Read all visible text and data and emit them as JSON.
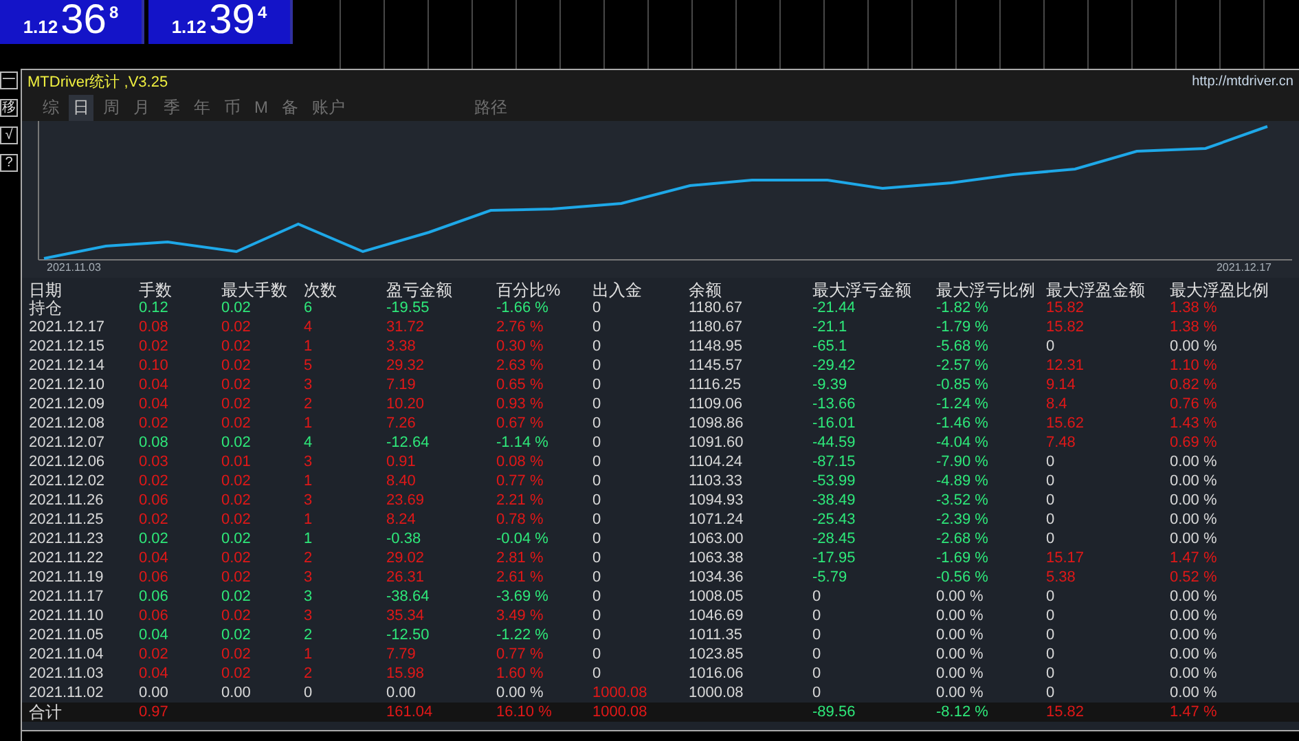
{
  "quotes": [
    {
      "prefix": "1.12",
      "big": "36",
      "sup": "8"
    },
    {
      "prefix": "1.12",
      "big": "39",
      "sup": "4"
    }
  ],
  "side_buttons": [
    "一",
    "移",
    "√",
    "?"
  ],
  "window": {
    "title": "MTDriver统计 ,V3.25",
    "url": "http://mtdriver.cn"
  },
  "tabs": [
    {
      "label": "综",
      "selected": false
    },
    {
      "label": "日",
      "selected": true
    },
    {
      "label": "周",
      "selected": false
    },
    {
      "label": "月",
      "selected": false
    },
    {
      "label": "季",
      "selected": false
    },
    {
      "label": "年",
      "selected": false
    },
    {
      "label": "币",
      "selected": false
    },
    {
      "label": "M",
      "selected": false
    },
    {
      "label": "备",
      "selected": false
    },
    {
      "label": "账户",
      "selected": false
    },
    {
      "label": "路径",
      "selected": false
    }
  ],
  "equity_chart": {
    "start_label": "2021.11.03",
    "end_label": "2021.12.17"
  },
  "table": {
    "columns": [
      "日期",
      "手数",
      "最大手数",
      "次数",
      "盈亏金额",
      "百分比%",
      "出入金",
      "余额",
      "最大浮亏金额",
      "最大浮亏比例",
      "最大浮盈金额",
      "最大浮盈比例"
    ],
    "rows": [
      {
        "kind": "open",
        "cells": [
          {
            "text": "持仓",
            "color": "#d8d8d8"
          },
          {
            "text": "0.12",
            "color": "#2ee87a"
          },
          {
            "text": "0.02",
            "color": "#2ee87a"
          },
          {
            "text": "6",
            "color": "#2ee87a"
          },
          {
            "text": "-19.55",
            "color": "#2ee87a"
          },
          {
            "text": "-1.66 %",
            "color": "#2ee87a"
          },
          {
            "text": "0",
            "color": "#d8d8d8"
          },
          {
            "text": "1180.67",
            "color": "#d8d8d8"
          },
          {
            "text": "-21.44",
            "color": "#2ee87a"
          },
          {
            "text": "-1.82 %",
            "color": "#2ee87a"
          },
          {
            "text": "15.82",
            "color": "#e01818"
          },
          {
            "text": "1.38 %",
            "color": "#e01818"
          }
        ]
      },
      {
        "kind": "day",
        "cells": [
          {
            "text": "2021.12.17",
            "color": "#d8d8d8"
          },
          {
            "text": "0.08",
            "color": "#e01818"
          },
          {
            "text": "0.02",
            "color": "#e01818"
          },
          {
            "text": "4",
            "color": "#e01818"
          },
          {
            "text": "31.72",
            "color": "#e01818"
          },
          {
            "text": "2.76 %",
            "color": "#e01818"
          },
          {
            "text": "0",
            "color": "#d8d8d8"
          },
          {
            "text": "1180.67",
            "color": "#d8d8d8"
          },
          {
            "text": "-21.1",
            "color": "#2ee87a"
          },
          {
            "text": "-1.79 %",
            "color": "#2ee87a"
          },
          {
            "text": "15.82",
            "color": "#e01818"
          },
          {
            "text": "1.38 %",
            "color": "#e01818"
          }
        ]
      },
      {
        "kind": "day",
        "cells": [
          {
            "text": "2021.12.15",
            "color": "#d8d8d8"
          },
          {
            "text": "0.02",
            "color": "#e01818"
          },
          {
            "text": "0.02",
            "color": "#e01818"
          },
          {
            "text": "1",
            "color": "#e01818"
          },
          {
            "text": "3.38",
            "color": "#e01818"
          },
          {
            "text": "0.30 %",
            "color": "#e01818"
          },
          {
            "text": "0",
            "color": "#d8d8d8"
          },
          {
            "text": "1148.95",
            "color": "#d8d8d8"
          },
          {
            "text": "-65.1",
            "color": "#2ee87a"
          },
          {
            "text": "-5.68 %",
            "color": "#2ee87a"
          },
          {
            "text": "0",
            "color": "#d8d8d8"
          },
          {
            "text": "0.00 %",
            "color": "#d8d8d8"
          }
        ]
      },
      {
        "kind": "day",
        "cells": [
          {
            "text": "2021.12.14",
            "color": "#d8d8d8"
          },
          {
            "text": "0.10",
            "color": "#e01818"
          },
          {
            "text": "0.02",
            "color": "#e01818"
          },
          {
            "text": "5",
            "color": "#e01818"
          },
          {
            "text": "29.32",
            "color": "#e01818"
          },
          {
            "text": "2.63 %",
            "color": "#e01818"
          },
          {
            "text": "0",
            "color": "#d8d8d8"
          },
          {
            "text": "1145.57",
            "color": "#d8d8d8"
          },
          {
            "text": "-29.42",
            "color": "#2ee87a"
          },
          {
            "text": "-2.57 %",
            "color": "#2ee87a"
          },
          {
            "text": "12.31",
            "color": "#e01818"
          },
          {
            "text": "1.10 %",
            "color": "#e01818"
          }
        ]
      },
      {
        "kind": "day",
        "cells": [
          {
            "text": "2021.12.10",
            "color": "#d8d8d8"
          },
          {
            "text": "0.04",
            "color": "#e01818"
          },
          {
            "text": "0.02",
            "color": "#e01818"
          },
          {
            "text": "3",
            "color": "#e01818"
          },
          {
            "text": "7.19",
            "color": "#e01818"
          },
          {
            "text": "0.65 %",
            "color": "#e01818"
          },
          {
            "text": "0",
            "color": "#d8d8d8"
          },
          {
            "text": "1116.25",
            "color": "#d8d8d8"
          },
          {
            "text": "-9.39",
            "color": "#2ee87a"
          },
          {
            "text": "-0.85 %",
            "color": "#2ee87a"
          },
          {
            "text": "9.14",
            "color": "#e01818"
          },
          {
            "text": "0.82 %",
            "color": "#e01818"
          }
        ]
      },
      {
        "kind": "day",
        "cells": [
          {
            "text": "2021.12.09",
            "color": "#d8d8d8"
          },
          {
            "text": "0.04",
            "color": "#e01818"
          },
          {
            "text": "0.02",
            "color": "#e01818"
          },
          {
            "text": "2",
            "color": "#e01818"
          },
          {
            "text": "10.20",
            "color": "#e01818"
          },
          {
            "text": "0.93 %",
            "color": "#e01818"
          },
          {
            "text": "0",
            "color": "#d8d8d8"
          },
          {
            "text": "1109.06",
            "color": "#d8d8d8"
          },
          {
            "text": "-13.66",
            "color": "#2ee87a"
          },
          {
            "text": "-1.24 %",
            "color": "#2ee87a"
          },
          {
            "text": "8.4",
            "color": "#e01818"
          },
          {
            "text": "0.76 %",
            "color": "#e01818"
          }
        ]
      },
      {
        "kind": "day",
        "cells": [
          {
            "text": "2021.12.08",
            "color": "#d8d8d8"
          },
          {
            "text": "0.02",
            "color": "#e01818"
          },
          {
            "text": "0.02",
            "color": "#e01818"
          },
          {
            "text": "1",
            "color": "#e01818"
          },
          {
            "text": "7.26",
            "color": "#e01818"
          },
          {
            "text": "0.67 %",
            "color": "#e01818"
          },
          {
            "text": "0",
            "color": "#d8d8d8"
          },
          {
            "text": "1098.86",
            "color": "#d8d8d8"
          },
          {
            "text": "-16.01",
            "color": "#2ee87a"
          },
          {
            "text": "-1.46 %",
            "color": "#2ee87a"
          },
          {
            "text": "15.62",
            "color": "#e01818"
          },
          {
            "text": "1.43 %",
            "color": "#e01818"
          }
        ]
      },
      {
        "kind": "day",
        "cells": [
          {
            "text": "2021.12.07",
            "color": "#d8d8d8"
          },
          {
            "text": "0.08",
            "color": "#2ee87a"
          },
          {
            "text": "0.02",
            "color": "#2ee87a"
          },
          {
            "text": "4",
            "color": "#2ee87a"
          },
          {
            "text": "-12.64",
            "color": "#2ee87a"
          },
          {
            "text": "-1.14 %",
            "color": "#2ee87a"
          },
          {
            "text": "0",
            "color": "#d8d8d8"
          },
          {
            "text": "1091.60",
            "color": "#d8d8d8"
          },
          {
            "text": "-44.59",
            "color": "#2ee87a"
          },
          {
            "text": "-4.04 %",
            "color": "#2ee87a"
          },
          {
            "text": "7.48",
            "color": "#e01818"
          },
          {
            "text": "0.69 %",
            "color": "#e01818"
          }
        ]
      },
      {
        "kind": "day",
        "cells": [
          {
            "text": "2021.12.06",
            "color": "#d8d8d8"
          },
          {
            "text": "0.03",
            "color": "#e01818"
          },
          {
            "text": "0.01",
            "color": "#e01818"
          },
          {
            "text": "3",
            "color": "#e01818"
          },
          {
            "text": "0.91",
            "color": "#e01818"
          },
          {
            "text": "0.08 %",
            "color": "#e01818"
          },
          {
            "text": "0",
            "color": "#d8d8d8"
          },
          {
            "text": "1104.24",
            "color": "#d8d8d8"
          },
          {
            "text": "-87.15",
            "color": "#2ee87a"
          },
          {
            "text": "-7.90 %",
            "color": "#2ee87a"
          },
          {
            "text": "0",
            "color": "#d8d8d8"
          },
          {
            "text": "0.00 %",
            "color": "#d8d8d8"
          }
        ]
      },
      {
        "kind": "day",
        "cells": [
          {
            "text": "2021.12.02",
            "color": "#d8d8d8"
          },
          {
            "text": "0.02",
            "color": "#e01818"
          },
          {
            "text": "0.02",
            "color": "#e01818"
          },
          {
            "text": "1",
            "color": "#e01818"
          },
          {
            "text": "8.40",
            "color": "#e01818"
          },
          {
            "text": "0.77 %",
            "color": "#e01818"
          },
          {
            "text": "0",
            "color": "#d8d8d8"
          },
          {
            "text": "1103.33",
            "color": "#d8d8d8"
          },
          {
            "text": "-53.99",
            "color": "#2ee87a"
          },
          {
            "text": "-4.89 %",
            "color": "#2ee87a"
          },
          {
            "text": "0",
            "color": "#d8d8d8"
          },
          {
            "text": "0.00 %",
            "color": "#d8d8d8"
          }
        ]
      },
      {
        "kind": "day",
        "cells": [
          {
            "text": "2021.11.26",
            "color": "#d8d8d8"
          },
          {
            "text": "0.06",
            "color": "#e01818"
          },
          {
            "text": "0.02",
            "color": "#e01818"
          },
          {
            "text": "3",
            "color": "#e01818"
          },
          {
            "text": "23.69",
            "color": "#e01818"
          },
          {
            "text": "2.21 %",
            "color": "#e01818"
          },
          {
            "text": "0",
            "color": "#d8d8d8"
          },
          {
            "text": "1094.93",
            "color": "#d8d8d8"
          },
          {
            "text": "-38.49",
            "color": "#2ee87a"
          },
          {
            "text": "-3.52 %",
            "color": "#2ee87a"
          },
          {
            "text": "0",
            "color": "#d8d8d8"
          },
          {
            "text": "0.00 %",
            "color": "#d8d8d8"
          }
        ]
      },
      {
        "kind": "day",
        "cells": [
          {
            "text": "2021.11.25",
            "color": "#d8d8d8"
          },
          {
            "text": "0.02",
            "color": "#e01818"
          },
          {
            "text": "0.02",
            "color": "#e01818"
          },
          {
            "text": "1",
            "color": "#e01818"
          },
          {
            "text": "8.24",
            "color": "#e01818"
          },
          {
            "text": "0.78 %",
            "color": "#e01818"
          },
          {
            "text": "0",
            "color": "#d8d8d8"
          },
          {
            "text": "1071.24",
            "color": "#d8d8d8"
          },
          {
            "text": "-25.43",
            "color": "#2ee87a"
          },
          {
            "text": "-2.39 %",
            "color": "#2ee87a"
          },
          {
            "text": "0",
            "color": "#d8d8d8"
          },
          {
            "text": "0.00 %",
            "color": "#d8d8d8"
          }
        ]
      },
      {
        "kind": "day",
        "cells": [
          {
            "text": "2021.11.23",
            "color": "#d8d8d8"
          },
          {
            "text": "0.02",
            "color": "#2ee87a"
          },
          {
            "text": "0.02",
            "color": "#2ee87a"
          },
          {
            "text": "1",
            "color": "#2ee87a"
          },
          {
            "text": "-0.38",
            "color": "#2ee87a"
          },
          {
            "text": "-0.04 %",
            "color": "#2ee87a"
          },
          {
            "text": "0",
            "color": "#d8d8d8"
          },
          {
            "text": "1063.00",
            "color": "#d8d8d8"
          },
          {
            "text": "-28.45",
            "color": "#2ee87a"
          },
          {
            "text": "-2.68 %",
            "color": "#2ee87a"
          },
          {
            "text": "0",
            "color": "#d8d8d8"
          },
          {
            "text": "0.00 %",
            "color": "#d8d8d8"
          }
        ]
      },
      {
        "kind": "day",
        "cells": [
          {
            "text": "2021.11.22",
            "color": "#d8d8d8"
          },
          {
            "text": "0.04",
            "color": "#e01818"
          },
          {
            "text": "0.02",
            "color": "#e01818"
          },
          {
            "text": "2",
            "color": "#e01818"
          },
          {
            "text": "29.02",
            "color": "#e01818"
          },
          {
            "text": "2.81 %",
            "color": "#e01818"
          },
          {
            "text": "0",
            "color": "#d8d8d8"
          },
          {
            "text": "1063.38",
            "color": "#d8d8d8"
          },
          {
            "text": "-17.95",
            "color": "#2ee87a"
          },
          {
            "text": "-1.69 %",
            "color": "#2ee87a"
          },
          {
            "text": "15.17",
            "color": "#e01818"
          },
          {
            "text": "1.47 %",
            "color": "#e01818"
          }
        ]
      },
      {
        "kind": "day",
        "cells": [
          {
            "text": "2021.11.19",
            "color": "#d8d8d8"
          },
          {
            "text": "0.06",
            "color": "#e01818"
          },
          {
            "text": "0.02",
            "color": "#e01818"
          },
          {
            "text": "3",
            "color": "#e01818"
          },
          {
            "text": "26.31",
            "color": "#e01818"
          },
          {
            "text": "2.61 %",
            "color": "#e01818"
          },
          {
            "text": "0",
            "color": "#d8d8d8"
          },
          {
            "text": "1034.36",
            "color": "#d8d8d8"
          },
          {
            "text": "-5.79",
            "color": "#2ee87a"
          },
          {
            "text": "-0.56 %",
            "color": "#2ee87a"
          },
          {
            "text": "5.38",
            "color": "#e01818"
          },
          {
            "text": "0.52 %",
            "color": "#e01818"
          }
        ]
      },
      {
        "kind": "day",
        "cells": [
          {
            "text": "2021.11.17",
            "color": "#d8d8d8"
          },
          {
            "text": "0.06",
            "color": "#2ee87a"
          },
          {
            "text": "0.02",
            "color": "#2ee87a"
          },
          {
            "text": "3",
            "color": "#2ee87a"
          },
          {
            "text": "-38.64",
            "color": "#2ee87a"
          },
          {
            "text": "-3.69 %",
            "color": "#2ee87a"
          },
          {
            "text": "0",
            "color": "#d8d8d8"
          },
          {
            "text": "1008.05",
            "color": "#d8d8d8"
          },
          {
            "text": "0",
            "color": "#d8d8d8"
          },
          {
            "text": "0.00 %",
            "color": "#d8d8d8"
          },
          {
            "text": "0",
            "color": "#d8d8d8"
          },
          {
            "text": "0.00 %",
            "color": "#d8d8d8"
          }
        ]
      },
      {
        "kind": "day",
        "cells": [
          {
            "text": "2021.11.10",
            "color": "#d8d8d8"
          },
          {
            "text": "0.06",
            "color": "#e01818"
          },
          {
            "text": "0.02",
            "color": "#e01818"
          },
          {
            "text": "3",
            "color": "#e01818"
          },
          {
            "text": "35.34",
            "color": "#e01818"
          },
          {
            "text": "3.49 %",
            "color": "#e01818"
          },
          {
            "text": "0",
            "color": "#d8d8d8"
          },
          {
            "text": "1046.69",
            "color": "#d8d8d8"
          },
          {
            "text": "0",
            "color": "#d8d8d8"
          },
          {
            "text": "0.00 %",
            "color": "#d8d8d8"
          },
          {
            "text": "0",
            "color": "#d8d8d8"
          },
          {
            "text": "0.00 %",
            "color": "#d8d8d8"
          }
        ]
      },
      {
        "kind": "day",
        "cells": [
          {
            "text": "2021.11.05",
            "color": "#d8d8d8"
          },
          {
            "text": "0.04",
            "color": "#2ee87a"
          },
          {
            "text": "0.02",
            "color": "#2ee87a"
          },
          {
            "text": "2",
            "color": "#2ee87a"
          },
          {
            "text": "-12.50",
            "color": "#2ee87a"
          },
          {
            "text": "-1.22 %",
            "color": "#2ee87a"
          },
          {
            "text": "0",
            "color": "#d8d8d8"
          },
          {
            "text": "1011.35",
            "color": "#d8d8d8"
          },
          {
            "text": "0",
            "color": "#d8d8d8"
          },
          {
            "text": "0.00 %",
            "color": "#d8d8d8"
          },
          {
            "text": "0",
            "color": "#d8d8d8"
          },
          {
            "text": "0.00 %",
            "color": "#d8d8d8"
          }
        ]
      },
      {
        "kind": "day",
        "cells": [
          {
            "text": "2021.11.04",
            "color": "#d8d8d8"
          },
          {
            "text": "0.02",
            "color": "#e01818"
          },
          {
            "text": "0.02",
            "color": "#e01818"
          },
          {
            "text": "1",
            "color": "#e01818"
          },
          {
            "text": "7.79",
            "color": "#e01818"
          },
          {
            "text": "0.77 %",
            "color": "#e01818"
          },
          {
            "text": "0",
            "color": "#d8d8d8"
          },
          {
            "text": "1023.85",
            "color": "#d8d8d8"
          },
          {
            "text": "0",
            "color": "#d8d8d8"
          },
          {
            "text": "0.00 %",
            "color": "#d8d8d8"
          },
          {
            "text": "0",
            "color": "#d8d8d8"
          },
          {
            "text": "0.00 %",
            "color": "#d8d8d8"
          }
        ]
      },
      {
        "kind": "day",
        "cells": [
          {
            "text": "2021.11.03",
            "color": "#d8d8d8"
          },
          {
            "text": "0.04",
            "color": "#e01818"
          },
          {
            "text": "0.02",
            "color": "#e01818"
          },
          {
            "text": "2",
            "color": "#e01818"
          },
          {
            "text": "15.98",
            "color": "#e01818"
          },
          {
            "text": "1.60 %",
            "color": "#e01818"
          },
          {
            "text": "0",
            "color": "#d8d8d8"
          },
          {
            "text": "1016.06",
            "color": "#d8d8d8"
          },
          {
            "text": "0",
            "color": "#d8d8d8"
          },
          {
            "text": "0.00 %",
            "color": "#d8d8d8"
          },
          {
            "text": "0",
            "color": "#d8d8d8"
          },
          {
            "text": "0.00 %",
            "color": "#d8d8d8"
          }
        ]
      },
      {
        "kind": "day",
        "cells": [
          {
            "text": "2021.11.02",
            "color": "#d8d8d8"
          },
          {
            "text": "0.00",
            "color": "#d8d8d8"
          },
          {
            "text": "0.00",
            "color": "#d8d8d8"
          },
          {
            "text": "0",
            "color": "#d8d8d8"
          },
          {
            "text": "0.00",
            "color": "#d8d8d8"
          },
          {
            "text": "0.00 %",
            "color": "#d8d8d8"
          },
          {
            "text": "1000.08",
            "color": "#e01818"
          },
          {
            "text": "1000.08",
            "color": "#d8d8d8"
          },
          {
            "text": "0",
            "color": "#d8d8d8"
          },
          {
            "text": "0.00 %",
            "color": "#d8d8d8"
          },
          {
            "text": "0",
            "color": "#d8d8d8"
          },
          {
            "text": "0.00 %",
            "color": "#d8d8d8"
          }
        ]
      },
      {
        "kind": "total",
        "cells": [
          {
            "text": "合计",
            "color": "#d8d8d8"
          },
          {
            "text": "0.97",
            "color": "#e01818"
          },
          null,
          null,
          {
            "text": "161.04",
            "color": "#e01818"
          },
          {
            "text": "16.10 %",
            "color": "#e01818"
          },
          {
            "text": "1000.08",
            "color": "#e01818"
          },
          null,
          {
            "text": "-89.56",
            "color": "#2ee87a"
          },
          {
            "text": "-8.12 %",
            "color": "#2ee87a"
          },
          {
            "text": "15.82",
            "color": "#e01818"
          },
          {
            "text": "1.47 %",
            "color": "#e01818"
          }
        ]
      }
    ]
  }
}
